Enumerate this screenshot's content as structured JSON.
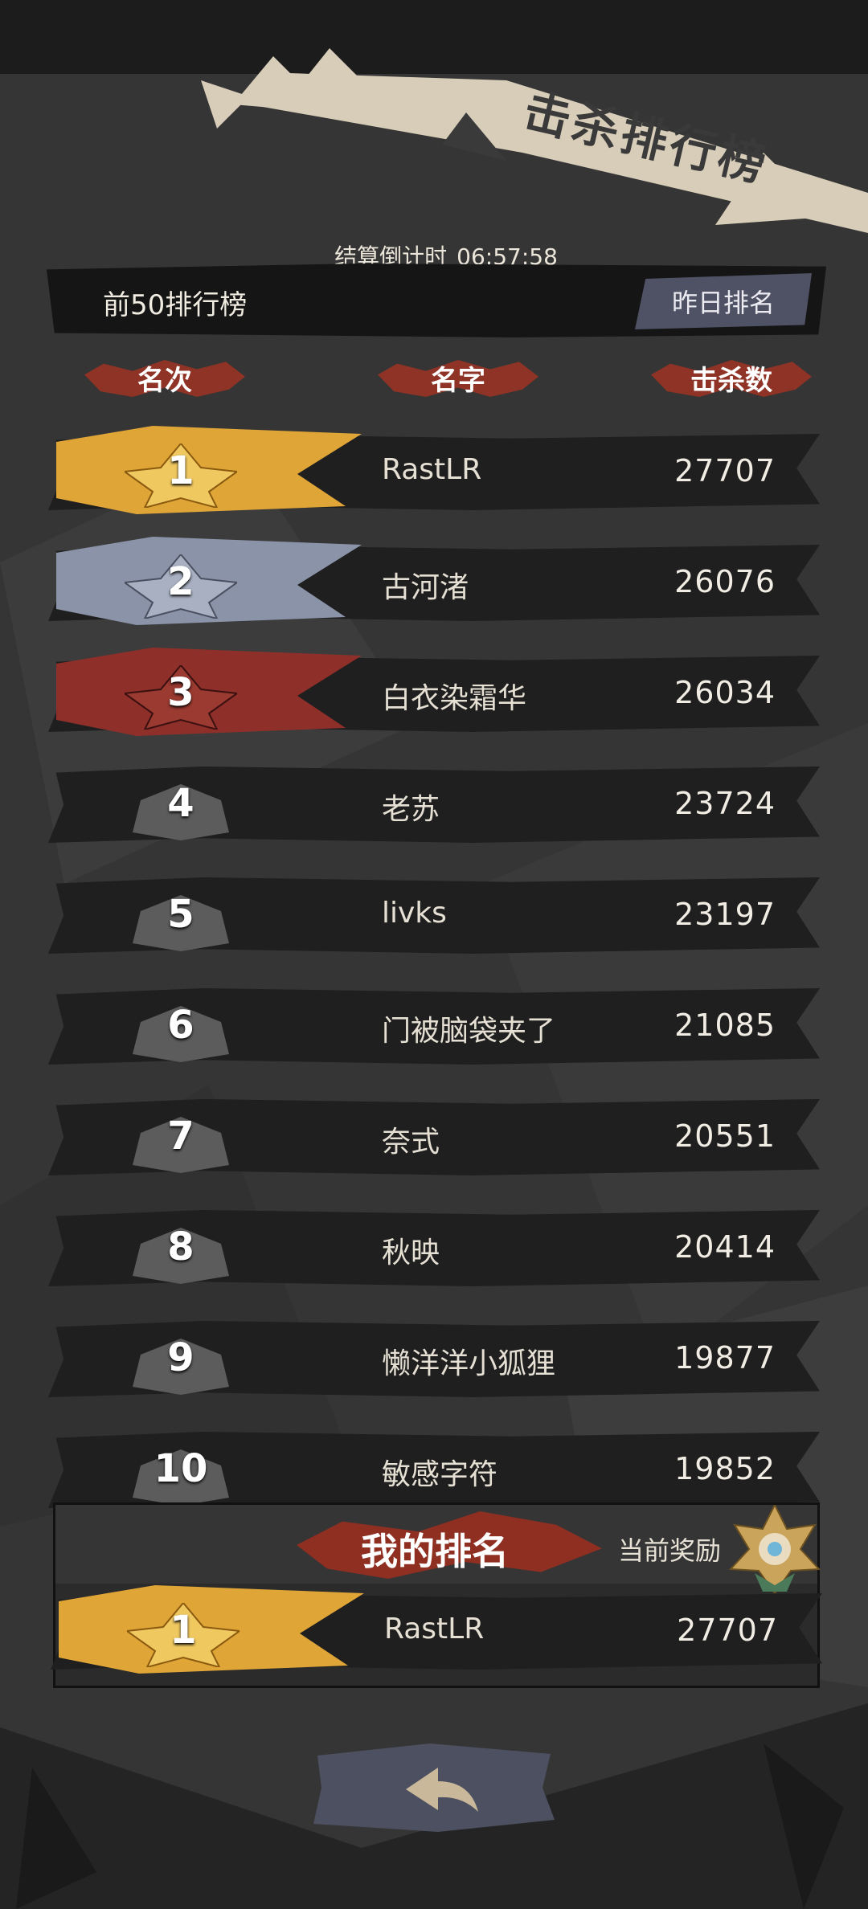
{
  "header": {
    "title": "击杀排行榜",
    "countdown_label": "结算倒计时",
    "countdown_value": "06:57:58",
    "board_label": "前50排行榜",
    "yesterday_button": "昨日排名"
  },
  "columns": {
    "rank": "名次",
    "name": "名字",
    "kills": "击杀数"
  },
  "rows": [
    {
      "rank": "1",
      "name": "RastLR",
      "kills": "27707",
      "tier": "gold"
    },
    {
      "rank": "2",
      "name": "古河渚",
      "kills": "26076",
      "tier": "silver"
    },
    {
      "rank": "3",
      "name": "白衣染霜华",
      "kills": "26034",
      "tier": "bronze"
    },
    {
      "rank": "4",
      "name": "老苏",
      "kills": "23724",
      "tier": "plain"
    },
    {
      "rank": "5",
      "name": "livks",
      "kills": "23197",
      "tier": "plain"
    },
    {
      "rank": "6",
      "name": "门被脑袋夹了",
      "kills": "21085",
      "tier": "plain"
    },
    {
      "rank": "7",
      "name": "奈式",
      "kills": "20551",
      "tier": "plain"
    },
    {
      "rank": "8",
      "name": "秋映",
      "kills": "20414",
      "tier": "plain"
    },
    {
      "rank": "9",
      "name": "懒洋洋小狐狸",
      "kills": "19877",
      "tier": "plain"
    },
    {
      "rank": "10",
      "name": "敏感字符",
      "kills": "19852",
      "tier": "plain"
    }
  ],
  "my_rank": {
    "title": "我的排名",
    "reward_label": "当前奖励",
    "rank": "1",
    "name": "RastLR",
    "kills": "27707",
    "tier": "gold"
  },
  "colors": {
    "gold": "#e0a537",
    "silver": "#8a93a8",
    "bronze": "#8f2f2a",
    "plain": "#6b6b6b",
    "brush_red": "#8e3325",
    "banner": "#d8cdb8"
  },
  "icons": {
    "back": "back-arrow-icon",
    "reward": "reward-medal-icon"
  }
}
